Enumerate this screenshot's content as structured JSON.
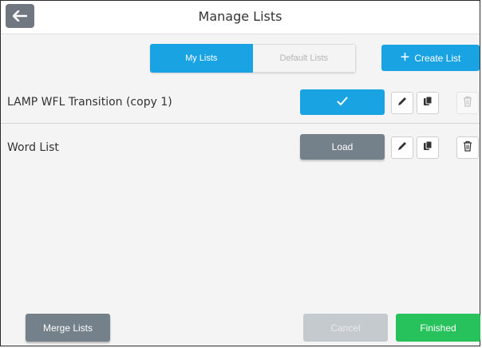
{
  "header": {
    "title": "Manage Lists",
    "back_icon": "arrow-left-icon"
  },
  "tabs": [
    {
      "label": "My Lists",
      "active": true
    },
    {
      "label": "Default Lists",
      "active": false
    }
  ],
  "create_button": {
    "label": "Create List",
    "icon": "plus-icon"
  },
  "lists": [
    {
      "name": "LAMP WFL Transition (copy 1)",
      "primary": {
        "type": "selected",
        "label": "✓",
        "icon": "checkmark-icon"
      },
      "actions": [
        "edit-pencil-icon",
        "copy-icon",
        "trash-icon"
      ],
      "delete_disabled": true
    },
    {
      "name": "Word List",
      "primary": {
        "type": "load",
        "label": "Load"
      },
      "actions": [
        "edit-pencil-icon",
        "copy-icon",
        "trash-icon"
      ],
      "delete_disabled": false
    }
  ],
  "footer": {
    "merge_label": "Merge Lists",
    "cancel_label": "Cancel",
    "finished_label": "Finished"
  },
  "colors": {
    "accent_blue": "#1aa3e3",
    "finished_green": "#27c25c",
    "neutral_gray": "#74808a"
  }
}
